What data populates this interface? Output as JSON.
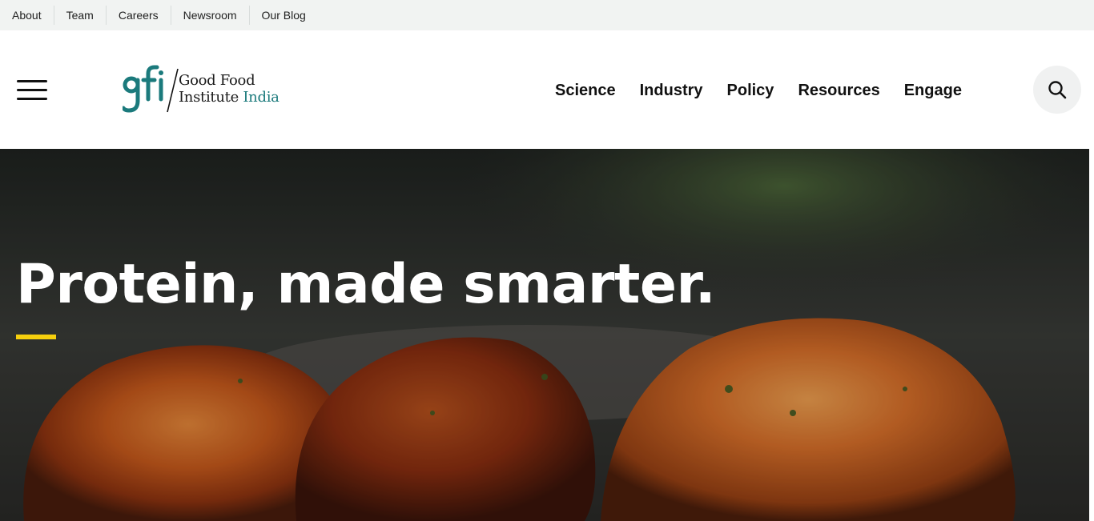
{
  "utility_nav": {
    "links": [
      "About",
      "Team",
      "Careers",
      "Newsroom",
      "Our Blog"
    ]
  },
  "header": {
    "logo": {
      "mark": "gfi",
      "line1": "Good Food",
      "line2_main": "Institute",
      "line2_accent": "India"
    },
    "nav": [
      "Science",
      "Industry",
      "Policy",
      "Resources",
      "Engage"
    ],
    "icons": {
      "menu": "hamburger-menu-icon",
      "search": "search-icon"
    }
  },
  "hero": {
    "title": "Protein, made smarter."
  },
  "colors": {
    "brand_teal": "#1b7a7c",
    "accent_yellow": "#f6cf0d",
    "utility_bg": "#f1f3f2",
    "hero_text": "#ffffff"
  }
}
